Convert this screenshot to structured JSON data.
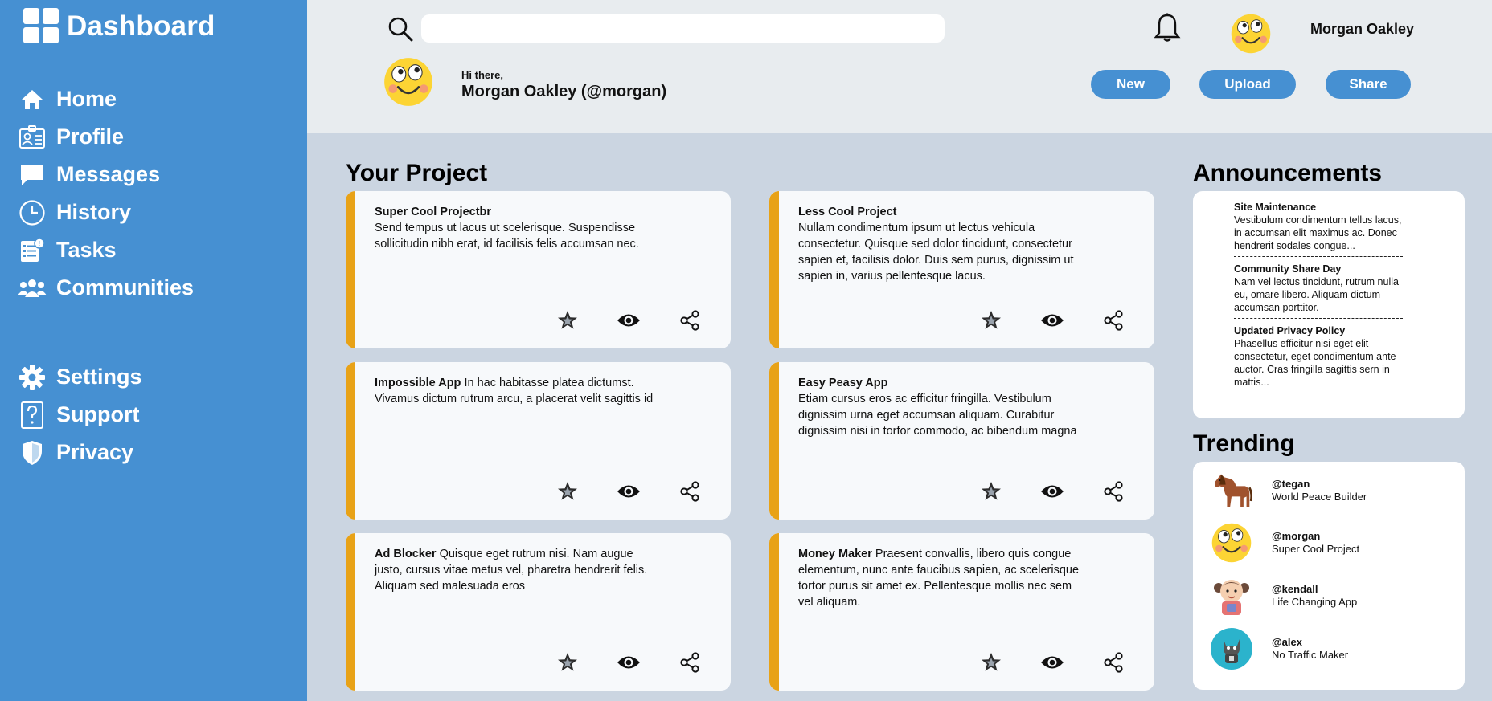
{
  "sidebar": {
    "brand": "Dashboard",
    "items": [
      {
        "label": "Home",
        "icon": "home-icon"
      },
      {
        "label": "Profile",
        "icon": "profile-card-icon"
      },
      {
        "label": "Messages",
        "icon": "chat-icon"
      },
      {
        "label": "History",
        "icon": "clock-icon"
      },
      {
        "label": "Tasks",
        "icon": "tasks-icon"
      },
      {
        "label": "Communities",
        "icon": "people-icon"
      }
    ],
    "secondary": [
      {
        "label": "Settings",
        "icon": "gear-icon"
      },
      {
        "label": "Support",
        "icon": "question-icon"
      },
      {
        "label": "Privacy",
        "icon": "shield-icon"
      }
    ]
  },
  "header": {
    "search_placeholder": "",
    "user_name": "Morgan Oakley",
    "greeting": "Hi there,",
    "greeting_name": "Morgan Oakley (@morgan)",
    "buttons": {
      "new": "New",
      "upload": "Upload",
      "share": "Share"
    }
  },
  "projects": {
    "title": "Your Project",
    "items": [
      {
        "name": "Super Cool Projectbr",
        "separate_line": true,
        "desc": "Send tempus ut lacus ut scelerisque. Suspendisse sollicitudin nibh erat, id facilisis felis accumsan nec."
      },
      {
        "name": "Less Cool Project",
        "separate_line": true,
        "desc": "Nullam condimentum ipsum ut lectus vehicula consectetur. Quisque sed dolor tincidunt, consectetur sapien et, facilisis dolor. Duis sem purus, dignissim ut sapien in, varius pellentesque lacus."
      },
      {
        "name": "Impossible App",
        "separate_line": false,
        "desc": "In hac habitasse platea dictumst. Vivamus dictum rutrum arcu, a placerat velit sagittis id"
      },
      {
        "name": "Easy Peasy App",
        "separate_line": true,
        "desc": "Etiam cursus eros ac efficitur fringilla. Vestibulum dignissim urna eget accumsan aliquam. Curabitur dignissim nisi in torfor commodo, ac bibendum magna"
      },
      {
        "name": "Ad Blocker",
        "separate_line": false,
        "desc": "Quisque eget rutrum nisi. Nam augue justo, cursus vitae metus vel, pharetra hendrerit felis. Aliquam sed malesuada eros"
      },
      {
        "name": "Money Maker",
        "separate_line": false,
        "desc": "Praesent convallis, libero quis congue elementum, nunc ante faucibus sapien, ac scelerisque tortor purus sit amet ex. Pellentesque mollis nec sem vel aliquam."
      }
    ]
  },
  "announcements": {
    "title": "Announcements",
    "items": [
      {
        "title": "Site Maintenance",
        "body": "Vestibulum condimentum tellus lacus, in accumsan elit maximus ac. Donec hendrerit sodales congue..."
      },
      {
        "title": "Community Share Day",
        "body": "Nam vel lectus tincidunt, rutrum nulla eu, omare libero. Aliquam dictum accumsan porttitor."
      },
      {
        "title": "Updated Privacy Policy",
        "body": "Phasellus efficitur nisi eget elit consectetur, eget condimentum ante auctor. Cras fringilla sagittis sern in mattis..."
      }
    ]
  },
  "trending": {
    "title": "Trending",
    "items": [
      {
        "handle": "@tegan",
        "project": "World Peace Builder",
        "avatar": "horse"
      },
      {
        "handle": "@morgan",
        "project": "Super Cool Project",
        "avatar": "smiley"
      },
      {
        "handle": "@kendall",
        "project": "Life Changing App",
        "avatar": "girl"
      },
      {
        "handle": "@alex",
        "project": "No Traffic Maker",
        "avatar": "cat"
      }
    ]
  },
  "colors": {
    "sidebar": "#4690d2",
    "accent": "#e8a217",
    "background": "#cbd5e1",
    "header": "#e8ecef"
  }
}
